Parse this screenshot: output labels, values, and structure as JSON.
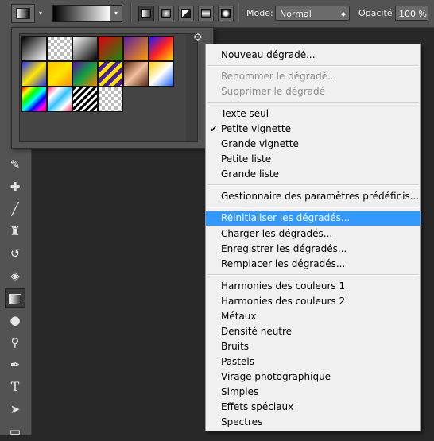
{
  "options_bar": {
    "tool_preset_icon": "gradient-tool-icon",
    "gradient_type_icons": [
      "linear-gradient-icon",
      "radial-gradient-icon",
      "angle-gradient-icon",
      "reflected-gradient-icon",
      "diamond-gradient-icon"
    ],
    "mode_label": "Mode:",
    "mode_value": "Normal",
    "opacity_label": "Opacité :",
    "opacity_value": "100 %"
  },
  "toolbar": {
    "tools": [
      "eyedropper-icon",
      "healing-brush-icon",
      "brush-icon",
      "clone-stamp-icon",
      "history-brush-icon",
      "eraser-icon",
      "gradient-icon",
      "blur-icon",
      "dodge-icon",
      "pen-icon",
      "type-icon",
      "path-selection-icon",
      "rectangle-shape-icon"
    ],
    "type_glyph": "T"
  },
  "picker": {
    "gear_icon": "gear-icon"
  },
  "menu": {
    "items": [
      {
        "label": "Nouveau dégradé...",
        "disabled": false
      },
      {
        "label": "Renommer le dégradé...",
        "disabled": true
      },
      {
        "label": "Supprimer le dégradé",
        "disabled": true
      },
      {
        "label": "Texte seul",
        "disabled": false
      },
      {
        "label": "Petite vignette",
        "disabled": false,
        "checked": true
      },
      {
        "label": "Grande vignette",
        "disabled": false
      },
      {
        "label": "Petite liste",
        "disabled": false
      },
      {
        "label": "Grande liste",
        "disabled": false
      },
      {
        "label": "Gestionnaire des paramètres prédéfinis...",
        "disabled": false
      },
      {
        "label": "Réinitialiser les dégradés...",
        "disabled": false,
        "highlighted": true
      },
      {
        "label": "Charger les dégradés...",
        "disabled": false
      },
      {
        "label": "Enregistrer les dégradés...",
        "disabled": false
      },
      {
        "label": "Remplacer les dégradés...",
        "disabled": false
      },
      {
        "label": "Harmonies des couleurs 1",
        "disabled": false
      },
      {
        "label": "Harmonies des couleurs 2",
        "disabled": false
      },
      {
        "label": "Métaux",
        "disabled": false
      },
      {
        "label": "Densité neutre",
        "disabled": false
      },
      {
        "label": "Bruits",
        "disabled": false
      },
      {
        "label": "Pastels",
        "disabled": false
      },
      {
        "label": "Virage photographique",
        "disabled": false
      },
      {
        "label": "Simples",
        "disabled": false
      },
      {
        "label": "Effets spéciaux",
        "disabled": false
      },
      {
        "label": "Spectres",
        "disabled": false
      }
    ],
    "check_glyph": "✔",
    "highlight_color": "#3399ff"
  }
}
